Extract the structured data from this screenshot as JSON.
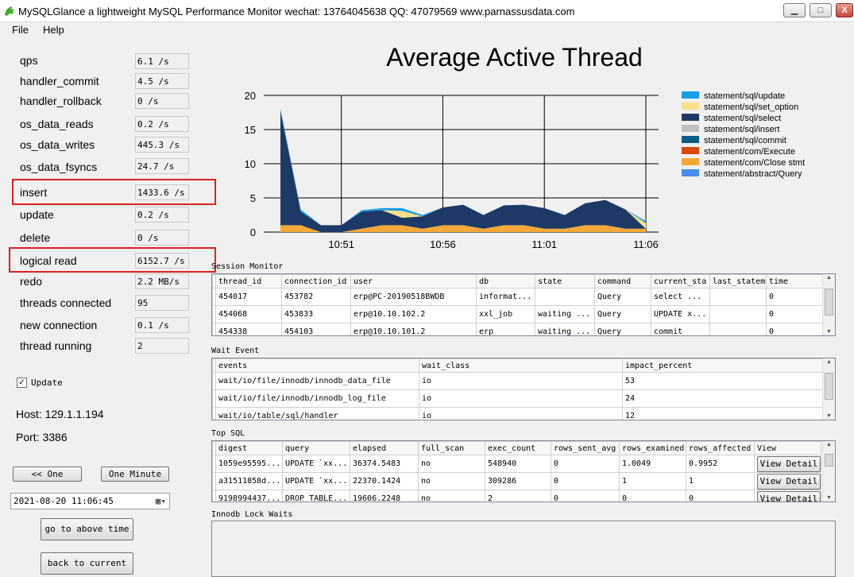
{
  "window": {
    "title": "MySQLGlance a lightweight MySQL Performance Monitor wechat: 13764045638 QQ: 47079569  www.parnassusdata.com",
    "minimize_glyph": "▁",
    "maximize_glyph": "□",
    "close_glyph": "X"
  },
  "menu": [
    "File",
    "Help"
  ],
  "metrics": [
    {
      "label": "qps",
      "value": "6.1 /s"
    },
    {
      "label": "handler_commit",
      "value": "4.5 /s"
    },
    {
      "label": "handler_rollback",
      "value": "0 /s"
    },
    {
      "label": "os_data_reads",
      "value": "0.2 /s"
    },
    {
      "label": "os_data_writes",
      "value": "445.3 /s"
    },
    {
      "label": "os_data_fsyncs",
      "value": "24.7 /s"
    },
    {
      "label": "insert",
      "value": "1433.6 /s"
    },
    {
      "label": "update",
      "value": "0.2 /s"
    },
    {
      "label": "delete",
      "value": "0 /s"
    },
    {
      "label": "logical read",
      "value": "6152.7 /s"
    },
    {
      "label": "redo",
      "value": "2.2 MB/s"
    },
    {
      "label": "threads connected",
      "value": "95"
    },
    {
      "label": "new connection",
      "value": "0.1 /s"
    },
    {
      "label": "thread running",
      "value": "2"
    }
  ],
  "update_checkbox": {
    "label": "Update",
    "checked": true,
    "check_glyph": "✓"
  },
  "host_text": "Host: 129.1.1.194",
  "port_text": "Port: 3386",
  "buttons": {
    "one": "<< One",
    "one_minute": "One Minute",
    "go_to_time": "go to above time",
    "back_to_current": "back to current"
  },
  "datetime": {
    "value": "2021-08-20 11:06:45",
    "dropdown_glyph": "▾"
  },
  "chart_data": {
    "type": "area",
    "title": "Average Active Thread",
    "ylim": [
      0,
      20
    ],
    "yticks": [
      0,
      5,
      10,
      15,
      20
    ],
    "xticks": [
      "10:51",
      "10:56",
      "11:01",
      "11:06"
    ],
    "x": [
      "10:48",
      "10:49",
      "10:50",
      "10:51",
      "10:52",
      "10:53",
      "10:54",
      "10:55",
      "10:56",
      "10:57",
      "10:58",
      "10:59",
      "11:00",
      "11:01",
      "11:02",
      "11:03",
      "11:04",
      "11:05",
      "11:06"
    ],
    "grid": true,
    "legend_position": "right",
    "series": [
      {
        "name": "statement/sql/update",
        "color": "#1a9ee6",
        "values": [
          0.2,
          0.3,
          0,
          0,
          0.2,
          0.3,
          0.4,
          0.2,
          0,
          0,
          0,
          0,
          0,
          0,
          0,
          0,
          0,
          0,
          0.3
        ]
      },
      {
        "name": "statement/sql/set_option",
        "color": "#f9e08c",
        "values": [
          0,
          0,
          0,
          0,
          0,
          0,
          1.0,
          0,
          0,
          0,
          0,
          0,
          0,
          0,
          0,
          0,
          0,
          0,
          0.8
        ]
      },
      {
        "name": "statement/sql/select",
        "color": "#1d3a66",
        "values": [
          16.8,
          2.0,
          1.0,
          1.0,
          2.5,
          2.2,
          1.1,
          1.8,
          2.6,
          3.0,
          2.0,
          2.9,
          3.0,
          3.0,
          2.0,
          3.2,
          3.7,
          2.8,
          0
        ]
      },
      {
        "name": "statement/sql/insert",
        "color": "#c0c0c0",
        "values": []
      },
      {
        "name": "statement/sql/commit",
        "color": "#0e5a8a",
        "values": []
      },
      {
        "name": "statement/com/Execute",
        "color": "#d9480f",
        "values": []
      },
      {
        "name": "statement/com/Close stmt",
        "color": "#f5a83a",
        "values": [
          1.0,
          1.0,
          0,
          0,
          0.5,
          1.0,
          1.0,
          0.5,
          1.0,
          1.0,
          0.5,
          1.0,
          1.0,
          0.5,
          0.5,
          1.0,
          1.0,
          0.5,
          0.5
        ]
      },
      {
        "name": "statement/abstract/Query",
        "color": "#4a8fe8",
        "values": []
      }
    ]
  },
  "session_monitor": {
    "label": "Session Monitor",
    "columns": [
      "thread_id",
      "connection_id",
      "user",
      "db",
      "state",
      "command",
      "current_sta",
      "last_statem",
      "time"
    ],
    "rows": [
      [
        "454017",
        "453782",
        "erp@PC-20190518BWDB",
        "informat...",
        "",
        "Query",
        "select  ...",
        "",
        "0"
      ],
      [
        "454068",
        "453833",
        "erp@10.10.102.2",
        "xxl_job",
        "waiting ...",
        "Query",
        "UPDATE x...",
        "",
        "0"
      ],
      [
        "454338",
        "454103",
        "erp@10.10.101.2",
        "erp",
        "waiting ...",
        "Query",
        "commit",
        "",
        "0"
      ]
    ]
  },
  "wait_event": {
    "label": "Wait Event",
    "columns": [
      "events",
      "wait_class",
      "impact_percent"
    ],
    "rows": [
      [
        "wait/io/file/innodb/innodb_data_file",
        "io",
        "53"
      ],
      [
        "wait/io/file/innodb/innodb_log_file",
        "io",
        "24"
      ],
      [
        "wait/io/table/sql/handler",
        "io",
        "12"
      ]
    ]
  },
  "top_sql": {
    "label": "Top SQL",
    "columns": [
      "digest",
      "query",
      "elapsed",
      "full_scan",
      "exec_count",
      "rows_sent_avg",
      "rows_examined",
      "rows_affected",
      "View"
    ],
    "view_button_label": "View Detail",
    "rows": [
      [
        "1059e95595...",
        "UPDATE `xx...",
        "36374.5483",
        "no",
        "548940",
        "0",
        "1.0049",
        "0.9952"
      ],
      [
        "a31511858d...",
        "UPDATE `xx...",
        "22370.1424",
        "no",
        "309286",
        "0",
        "1",
        "1"
      ],
      [
        "9198994437...",
        "DROP TABLE...",
        "19606.2248",
        "no",
        "2",
        "0",
        "0",
        "0"
      ]
    ]
  },
  "innodb_lock_waits": {
    "label": "Innodb Lock Waits"
  },
  "scroll": {
    "up": "▲",
    "down": "▼"
  }
}
